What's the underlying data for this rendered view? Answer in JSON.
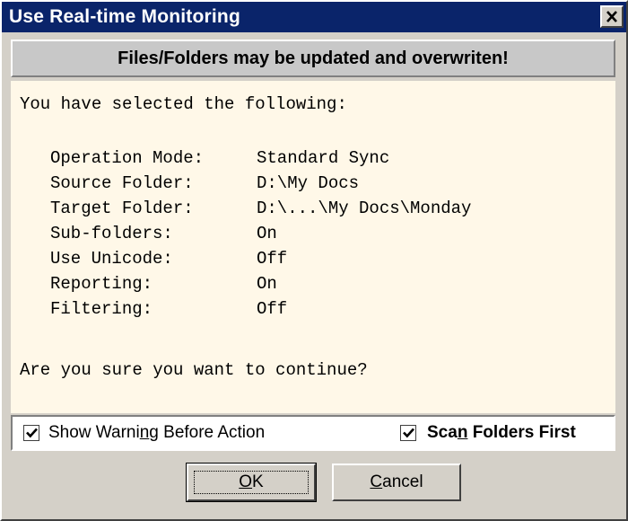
{
  "window": {
    "title": "Use Real-time Monitoring"
  },
  "banner": {
    "text": "Files/Folders may be updated and overwriten!"
  },
  "content": {
    "intro": "You have selected the following:",
    "summary": [
      {
        "key": "Operation Mode:",
        "value": "Standard Sync"
      },
      {
        "key": "Source Folder:",
        "value": "D:\\My Docs"
      },
      {
        "key": "Target Folder:",
        "value": "D:\\...\\My Docs\\Monday"
      },
      {
        "key": "Sub-folders:",
        "value": "On"
      },
      {
        "key": "Use Unicode:",
        "value": "Off"
      },
      {
        "key": "Reporting:",
        "value": "On"
      },
      {
        "key": "Filtering:",
        "value": "Off"
      }
    ],
    "question": "Are you sure you want to continue?"
  },
  "options": {
    "show_warning": {
      "pre": "Show Warni",
      "accel": "n",
      "post": "g Before Action",
      "checked": true
    },
    "scan_folders": {
      "pre": "Sca",
      "accel": "n",
      "post": " Folders First",
      "checked": true
    }
  },
  "buttons": {
    "ok": {
      "accel": "O",
      "rest": "K"
    },
    "cancel": {
      "accel": "C",
      "rest": "ancel"
    }
  }
}
